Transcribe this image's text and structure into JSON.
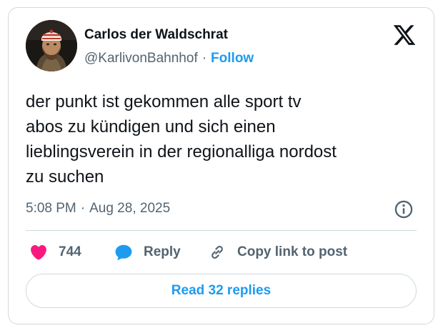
{
  "author": {
    "display_name": "Carlos der Waldschrat",
    "handle": "@KarlivonBahnhof",
    "separator": "·",
    "follow_label": "Follow"
  },
  "tweet": {
    "text": "der punkt ist gekommen alle sport tv\nabos zu kündigen und sich einen\nlieblingsverein in der regionalliga nordost\nzu suchen",
    "time": "5:08 PM",
    "separator": "·",
    "date": "Aug 28, 2025"
  },
  "actions": {
    "like_count": "744",
    "reply_label": "Reply",
    "copy_link_label": "Copy link to post"
  },
  "footer": {
    "read_replies_label": "Read 32 replies"
  },
  "icons": {
    "brand": "x-logo-icon",
    "info": "info-icon",
    "like": "heart-icon",
    "reply": "speech-bubble-icon",
    "copy_link": "link-icon"
  },
  "colors": {
    "accent": "#1d9bf0",
    "like": "#f91880",
    "text": "#0f1419",
    "secondary_text": "#536471",
    "border": "#cfd9de"
  }
}
